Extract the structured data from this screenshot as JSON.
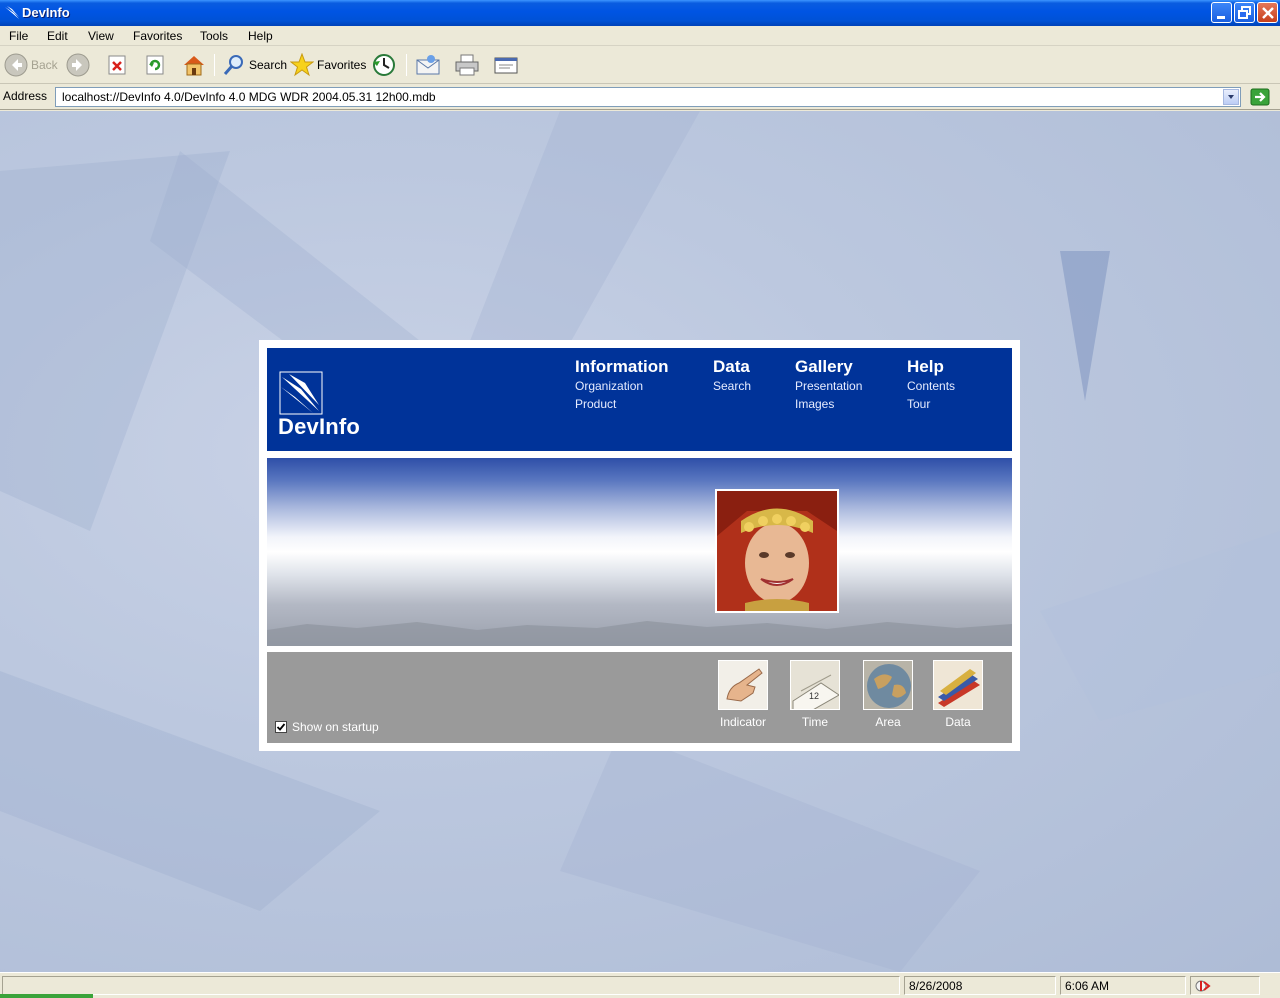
{
  "window": {
    "title": "DevInfo"
  },
  "menu": [
    "File",
    "Edit",
    "View",
    "Favorites",
    "Tools",
    "Help"
  ],
  "toolbar": {
    "back_label": "Back",
    "search_label": "Search",
    "favorites_label": "Favorites"
  },
  "address": {
    "label": "Address",
    "value": "localhost://DevInfo 4.0/DevInfo 4.0 MDG WDR 2004.05.31 12h00.mdb"
  },
  "devinfo": {
    "logo_text": "DevInfo",
    "nav": [
      {
        "head": "Information",
        "subs": [
          "Organization",
          "Product"
        ]
      },
      {
        "head": "Data",
        "subs": [
          "Search"
        ]
      },
      {
        "head": "Gallery",
        "subs": [
          "Presentation",
          "Images"
        ]
      },
      {
        "head": "Help",
        "subs": [
          "Contents",
          "Tour"
        ]
      }
    ],
    "shortcuts": [
      {
        "label": "Indicator",
        "icon": "pointing-hand-icon"
      },
      {
        "label": "Time",
        "icon": "calendar-icon"
      },
      {
        "label": "Area",
        "icon": "globe-icon"
      },
      {
        "label": "Data",
        "icon": "books-icon"
      }
    ],
    "startup": {
      "label": "Show on startup",
      "checked": true
    }
  },
  "status": {
    "date": "8/26/2008",
    "time": "6:06 AM"
  },
  "colors": {
    "header": "#003399",
    "titlebar": "#0054e3",
    "panel": "#9a9a9a"
  }
}
